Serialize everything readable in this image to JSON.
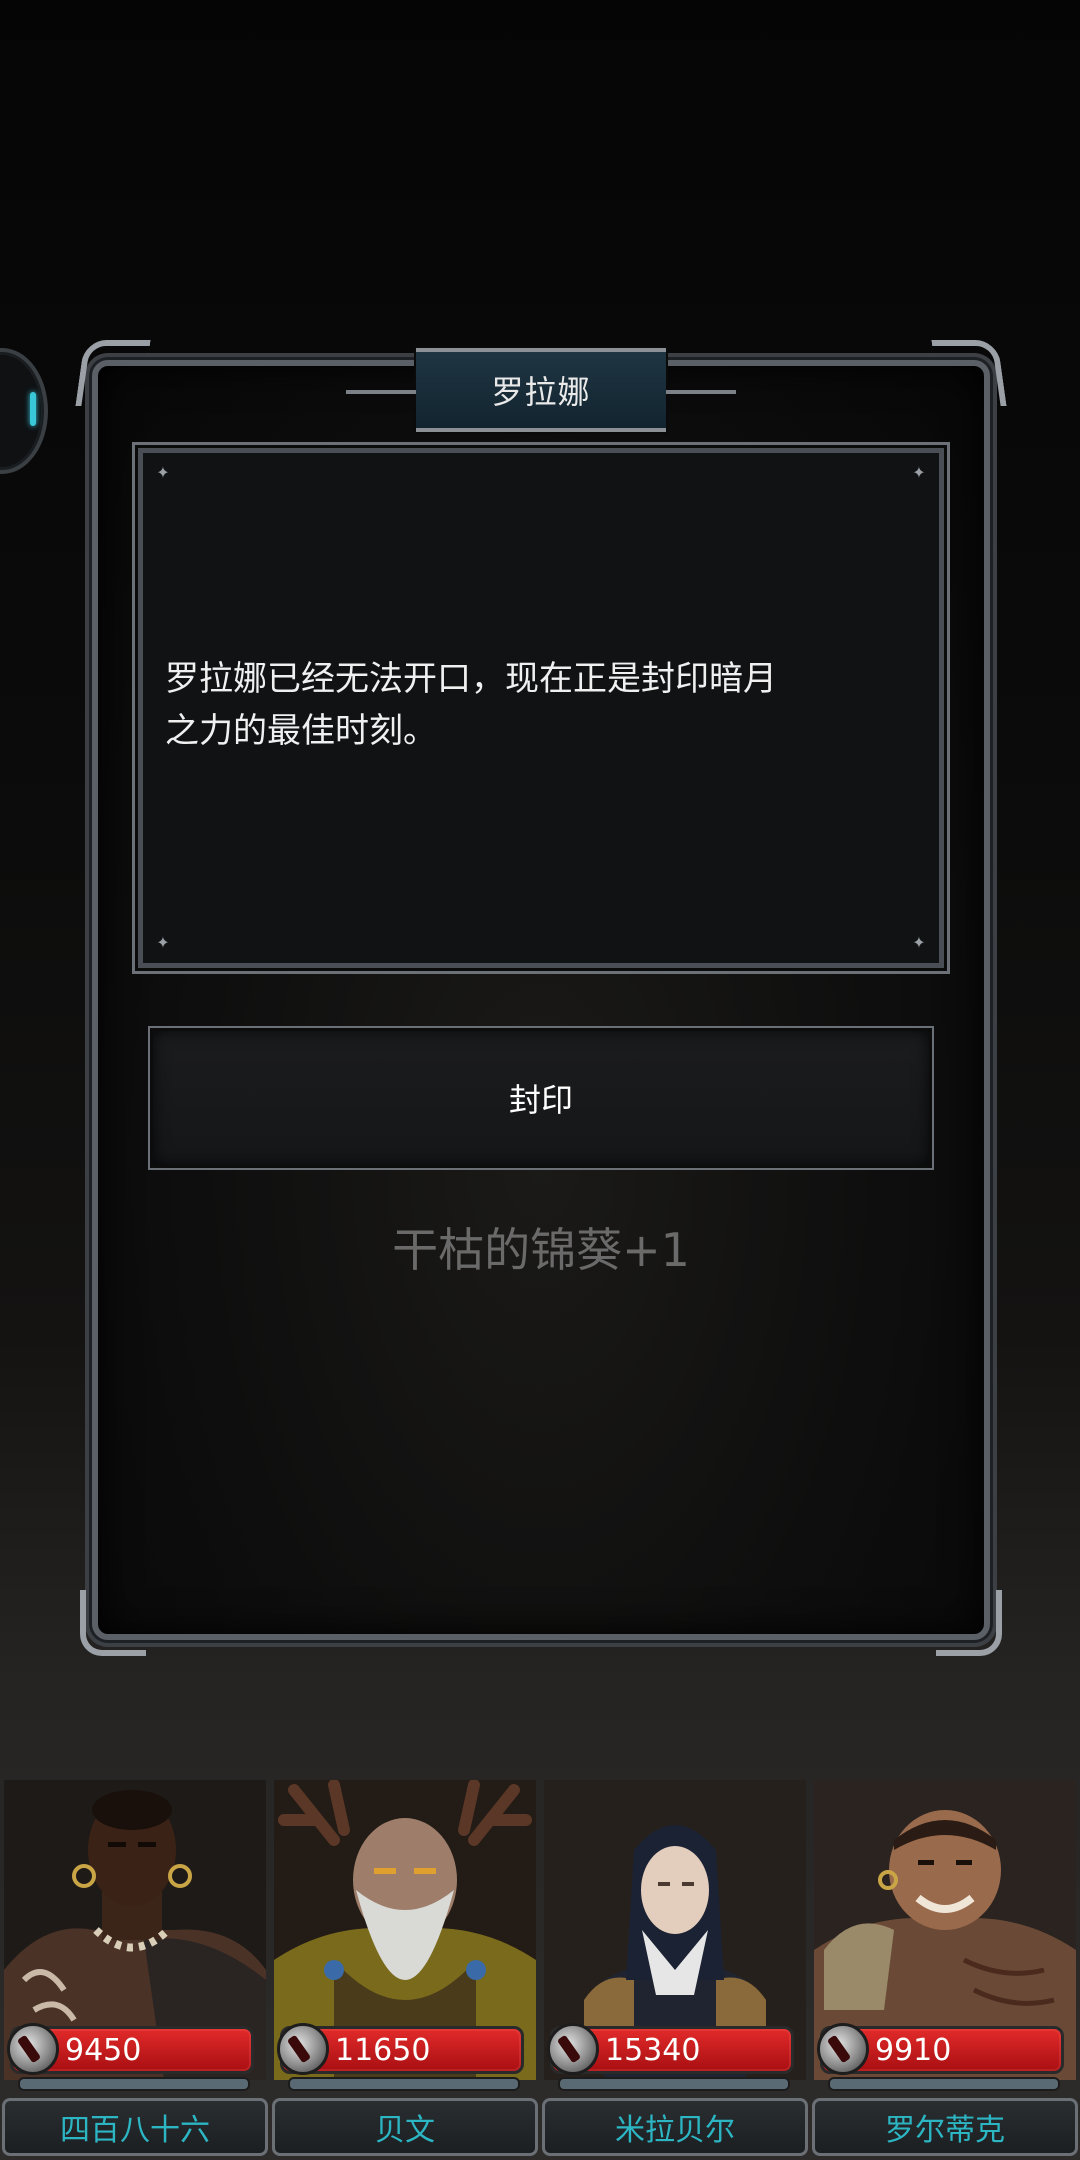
{
  "dialog": {
    "title": "罗拉娜",
    "message": "罗拉娜已经无法开口，现在正是封印暗月\n之力的最佳时刻。",
    "action_label": "封印",
    "reward_text": "干枯的锦葵+1"
  },
  "party": [
    {
      "name": "四百八十六",
      "hp": "9450",
      "portrait": "tribal-warrior"
    },
    {
      "name": "贝文",
      "hp": "11650",
      "portrait": "antlered-druid"
    },
    {
      "name": "米拉贝尔",
      "hp": "15340",
      "portrait": "nun"
    },
    {
      "name": "罗尔蒂克",
      "hp": "9910",
      "portrait": "brute"
    }
  ],
  "colors": {
    "hp_bar": "#c81a1d",
    "name_text": "#2cb6c4",
    "frame": "#5b6066",
    "title_plate": "#1a2f3b"
  }
}
